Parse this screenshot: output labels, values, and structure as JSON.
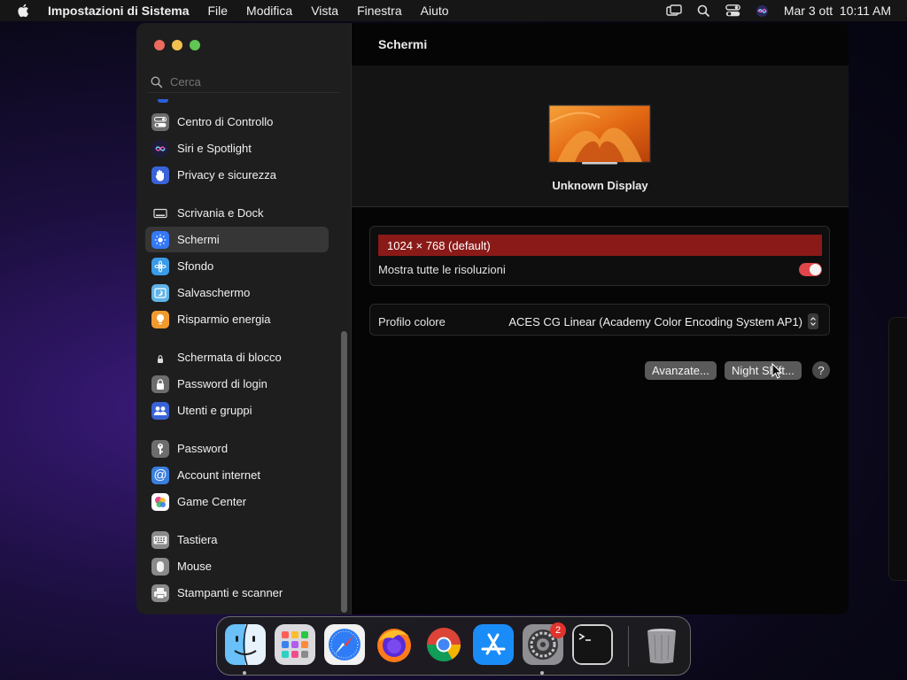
{
  "menubar": {
    "app_name": "Impostazioni di Sistema",
    "menus": [
      "File",
      "Modifica",
      "Vista",
      "Finestra",
      "Aiuto"
    ],
    "datetime": "Mar 3 ott  10:11 AM",
    "status_icons": [
      "screen-mirroring-icon",
      "search-icon",
      "control-center-icon",
      "siri-icon"
    ]
  },
  "window": {
    "search_placeholder": "Cerca",
    "sidebar": {
      "items": [
        {
          "label": "Centro di Controllo",
          "icon": "control-center-icon"
        },
        {
          "label": "Siri e Spotlight",
          "icon": "siri-icon"
        },
        {
          "label": "Privacy e sicurezza",
          "icon": "hand-icon"
        },
        {
          "label": "Scrivania e Dock",
          "icon": "dock-icon"
        },
        {
          "label": "Schermi",
          "icon": "display-icon",
          "selected": true
        },
        {
          "label": "Sfondo",
          "icon": "wallpaper-icon"
        },
        {
          "label": "Salvaschermo",
          "icon": "screensaver-icon"
        },
        {
          "label": "Risparmio energia",
          "icon": "lightbulb-icon"
        },
        {
          "label": "Schermata di blocco",
          "icon": "lock-screen-icon"
        },
        {
          "label": "Password di login",
          "icon": "lock-icon"
        },
        {
          "label": "Utenti e gruppi",
          "icon": "users-icon"
        },
        {
          "label": "Password",
          "icon": "key-icon"
        },
        {
          "label": "Account internet",
          "icon": "at-icon"
        },
        {
          "label": "Game Center",
          "icon": "game-center-icon"
        },
        {
          "label": "Tastiera",
          "icon": "keyboard-icon"
        },
        {
          "label": "Mouse",
          "icon": "mouse-icon"
        },
        {
          "label": "Stampanti e scanner",
          "icon": "printer-icon"
        }
      ]
    },
    "main": {
      "title": "Schermi",
      "display_name": "Unknown Display",
      "resolution": "1024 × 768 (default)",
      "show_all_label": "Mostra tutte le risoluzioni",
      "show_all_enabled": true,
      "profile_label": "Profilo colore",
      "profile_value": "ACES CG Linear (Academy Color Encoding System AP1)",
      "advanced_button": "Avanzate...",
      "night_shift_button": "Night Shift...",
      "help_button": "?"
    }
  },
  "dock": {
    "apps": [
      "Finder",
      "Launchpad",
      "Safari",
      "Firefox",
      "Chrome",
      "App Store",
      "Impostazioni di Sistema",
      "Terminale",
      "Cestino"
    ],
    "settings_badge": "2"
  },
  "colors": {
    "accent": "#e0474b",
    "selection_row": "#8a1a18",
    "sidebar_selected": "#363636"
  }
}
